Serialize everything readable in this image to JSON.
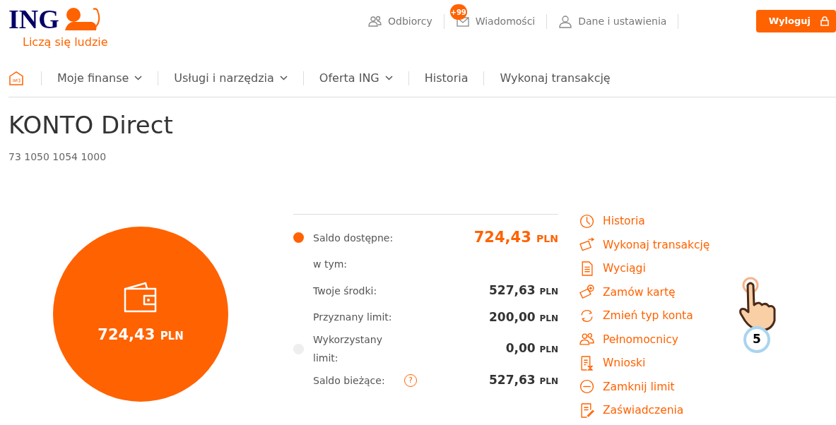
{
  "brand": {
    "logo": "ING",
    "tagline": "Liczą się ludzie"
  },
  "top_nav": [
    {
      "kind": "recipients",
      "label": "Odbiorcy"
    },
    {
      "kind": "messages",
      "label": "Wiadomości",
      "badge": "+99"
    },
    {
      "kind": "user",
      "label": "Dane i ustawienia"
    }
  ],
  "logout_button": "Wyloguj",
  "main_nav": [
    {
      "label": "Moje finanse",
      "dropdown": true
    },
    {
      "label": "Usługi i narzędzia",
      "dropdown": true
    },
    {
      "label": "Oferta ING",
      "dropdown": true
    },
    {
      "label": "Historia",
      "dropdown": false
    },
    {
      "label": "Wykonaj transakcję",
      "dropdown": false
    }
  ],
  "account": {
    "title": "KONTO Direct",
    "number": "73 1050 1054 1000",
    "circle_amount": "724,43",
    "circle_currency": "PLN"
  },
  "balances": [
    {
      "label": "Saldo dostępne:",
      "amount": "724,43",
      "currency": "PLN",
      "color": "#ff6200",
      "highlight": true
    },
    {
      "label": "w tym:"
    },
    {
      "label": "Twoje środki:",
      "amount": "527,63",
      "currency": "PLN",
      "highlight": false
    },
    {
      "label": "Przyznany limit:",
      "amount": "200,00",
      "currency": "PLN",
      "highlight": false
    },
    {
      "label": "Wykorzystany limit:",
      "amount": "0,00",
      "currency": "PLN",
      "color": "#eeeeee",
      "highlight": false
    },
    {
      "label": "Saldo bieżące:",
      "amount": "527,63",
      "currency": "PLN",
      "highlight": false,
      "help_icon": "?"
    }
  ],
  "actions": [
    {
      "kind": "clock",
      "label": "Historia"
    },
    {
      "kind": "transfer",
      "label": "Wykonaj transakcję"
    },
    {
      "kind": "document",
      "label": "Wyciągi"
    },
    {
      "kind": "card",
      "label": "Zamów kartę"
    },
    {
      "kind": "refresh",
      "label": "Zmień typ konta"
    },
    {
      "kind": "people",
      "label": "Pełnomocnicy"
    },
    {
      "kind": "form",
      "label": "Wnioski"
    },
    {
      "kind": "minus",
      "label": "Zamknij limit"
    },
    {
      "kind": "certificate",
      "label": "Zaświadczenia"
    }
  ],
  "tutorial_step": "5"
}
